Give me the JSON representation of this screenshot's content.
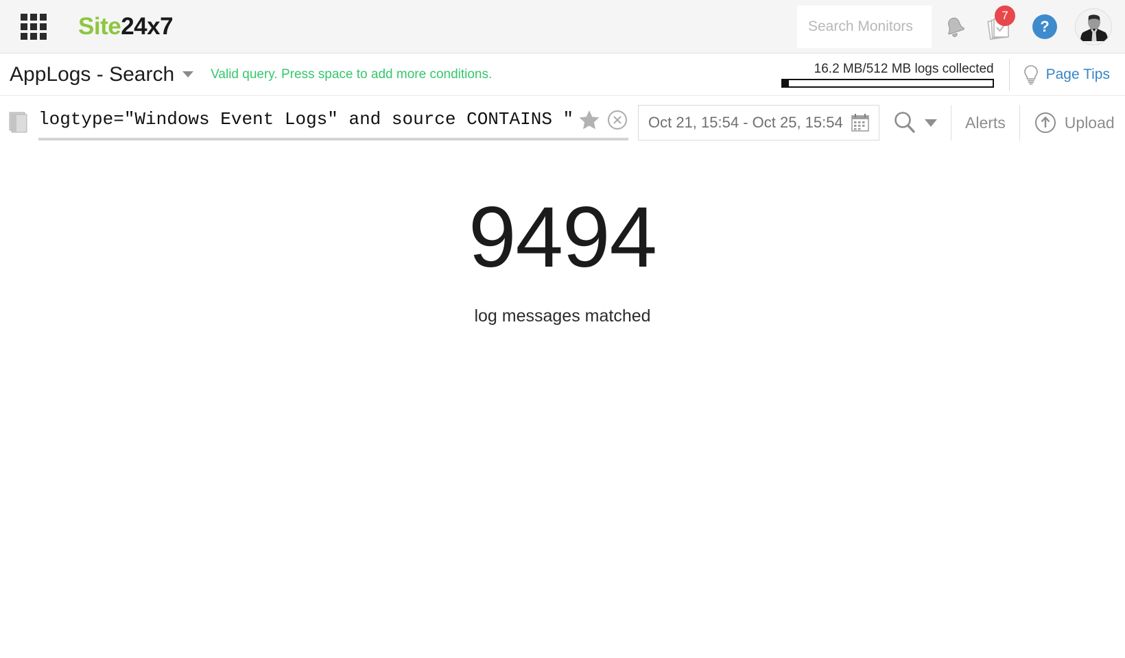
{
  "header": {
    "apps_icon": "apps-grid-icon",
    "brand_green": "Site",
    "brand_dark": "24x7",
    "brand_color_green": "#8dc63f",
    "brand_color_dark": "#1a1a1a",
    "search_placeholder": "Search Monitors",
    "search_value": "",
    "bell_icon": "bell-icon",
    "tasks_icon": "tasks-checklist-icon",
    "notification_count": "7",
    "notification_color": "#e8474b",
    "help_icon_label": "?",
    "help_color": "#3d8bcd",
    "avatar_icon": "user-avatar"
  },
  "titlebar": {
    "title": "AppLogs - Search",
    "caret_icon": "chevron-down-icon",
    "status_message": "Valid query. Press space to add more conditions.",
    "status_color": "#33c76d",
    "quota_label": "16.2 MB/512 MB logs collected",
    "quota_used_mb": "16.2",
    "quota_total_mb": "512",
    "quota_percent": 3.16,
    "page_tips_label": "Page Tips",
    "page_tips_icon": "lightbulb-icon",
    "page_tips_color": "#3884c8"
  },
  "querybar": {
    "stack_icon": "log-stack-icon",
    "query_value": "logtype=\"Windows Event Logs\" and source CONTAINS \"Microso",
    "favorite_icon": "star-icon",
    "clear_icon": "clear-circle-icon",
    "date_range": "Oct 21, 15:54 - Oct 25, 15:54",
    "calendar_icon": "calendar-icon",
    "search_icon": "magnifier-icon",
    "search_caret_icon": "chevron-down-icon",
    "alerts_label": "Alerts",
    "upload_label": "Upload",
    "upload_icon": "upload-circle-icon"
  },
  "results": {
    "count": "9494",
    "caption": "log messages matched"
  }
}
